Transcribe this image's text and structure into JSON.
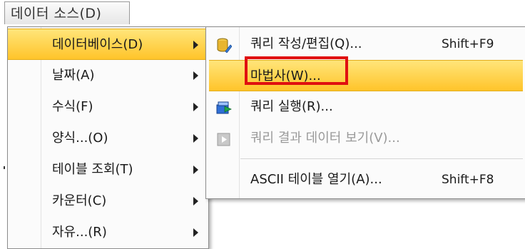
{
  "menubar": {
    "title": "데이터 소스(D)"
  },
  "menu": {
    "items": [
      {
        "label": "데이터베이스(D)",
        "has_submenu": true,
        "highlighted": true
      },
      {
        "label": "날짜(A)",
        "has_submenu": true
      },
      {
        "label": "수식(F)",
        "has_submenu": true
      },
      {
        "label": "양식...(O)",
        "has_submenu": true
      },
      {
        "label": "테이블 조회(T)",
        "has_submenu": true
      },
      {
        "label": "카운터(C)",
        "has_submenu": true
      },
      {
        "label": "자유...(R)",
        "has_submenu": true
      }
    ]
  },
  "submenu": {
    "items": [
      {
        "label": "쿼리 작성/편집(Q)...",
        "shortcut": "Shift+F9",
        "icon": "database-edit-icon"
      },
      {
        "label": "마법사(W)...",
        "shortcut": "",
        "icon": "",
        "highlighted": true
      },
      {
        "label": "쿼리 실행(R)...",
        "shortcut": "",
        "icon": "run-query-icon"
      },
      {
        "label": "쿼리 결과 데이터 보기(V)...",
        "shortcut": "",
        "icon": "query-result-icon",
        "disabled": true
      },
      {
        "label": "ASCII 테이블 열기(A)...",
        "shortcut": "Shift+F8",
        "icon": ""
      }
    ]
  },
  "colors": {
    "highlight_top": "#ffe57a",
    "highlight_bottom": "#ffc42a",
    "red_box": "#e01010",
    "disabled_text": "#9a9a9a"
  }
}
